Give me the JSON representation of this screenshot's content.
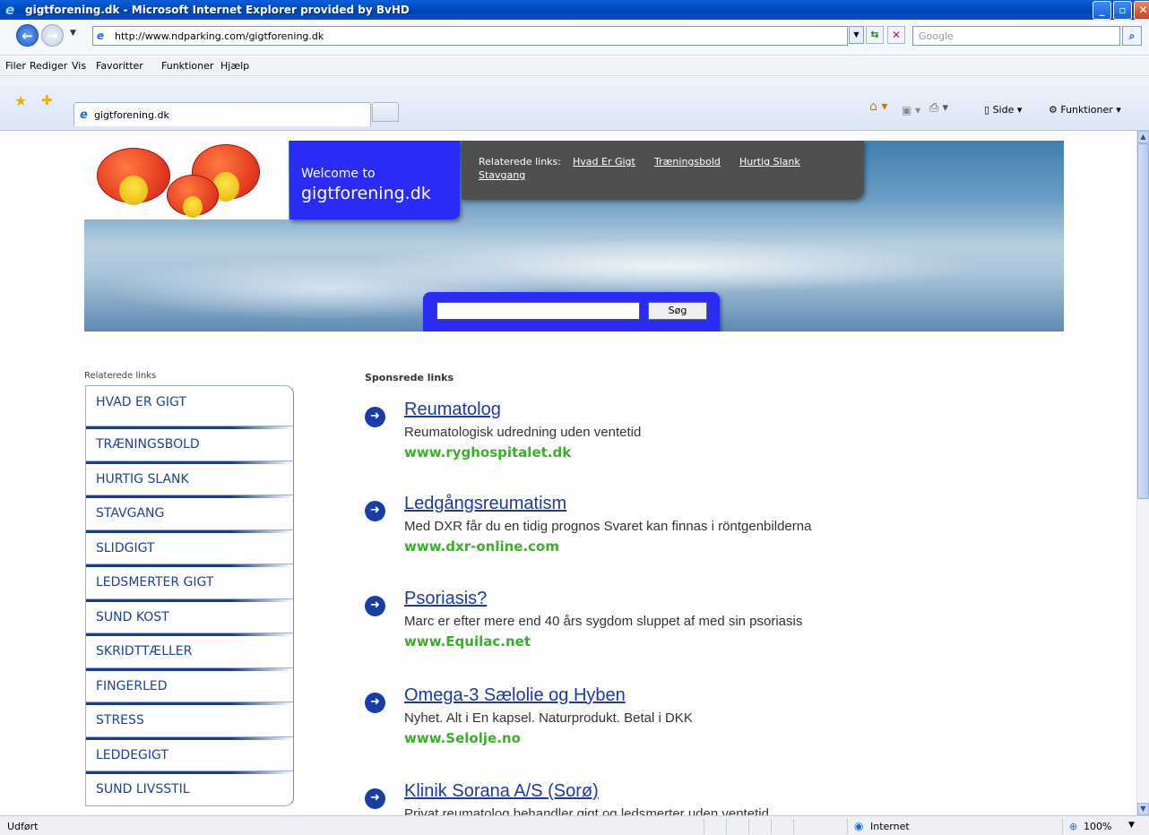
{
  "window": {
    "title": "gigtforening.dk - Microsoft Internet Explorer provided by BvHD"
  },
  "address": {
    "url": "http://www.ndparking.com/gigtforening.dk",
    "search_placeholder": "Google"
  },
  "menu": [
    "Filer",
    "Rediger",
    "Vis",
    "Favoritter",
    "Funktioner",
    "Hjælp"
  ],
  "tab": {
    "label": "gigtforening.dk"
  },
  "toolbar": {
    "page_label": "Side",
    "tools_label": "Funktioner"
  },
  "hero": {
    "welcome_line1": "Welcome to",
    "welcome_line2": "gigtforening.dk",
    "related_label": "Relaterede links:",
    "related_links": [
      "Hvad Er Gigt",
      "Træningsbold",
      "Hurtig Slank",
      "Stavgang"
    ],
    "search_button": "Søg"
  },
  "sidebar": {
    "title": "Relaterede links",
    "items": [
      "HVAD ER GIGT",
      "TRÆNINGSBOLD",
      "HURTIG SLANK",
      "STAVGANG",
      "SLIDGIGT",
      "LEDSMERTER GIGT",
      "SUND KOST",
      "SKRIDTTÆLLER",
      "FINGERLED",
      "STRESS",
      "LEDDEGIGT",
      "SUND LIVSSTIL"
    ]
  },
  "sponsored": {
    "title": "Sponsrede links",
    "ads": [
      {
        "headline": "Reumatolog",
        "desc": "Reumatologisk udredning uden ventetid",
        "url": "www.ryghospitalet.dk"
      },
      {
        "headline": "Ledgångsreumatism",
        "desc": "Med DXR får du en tidig prognos Svaret kan finnas i röntgenbilderna",
        "url": "www.dxr-online.com"
      },
      {
        "headline": "Psoriasis?",
        "desc": "Marc er efter mere end 40 års sygdom sluppet af med sin psoriasis",
        "url": "www.Equilac.net"
      },
      {
        "headline": "Omega-3 Sælolie og Hyben",
        "desc": "Nyhet. Alt i En kapsel. Naturprodukt. Betal i DKK",
        "url": "www.Selolje.no"
      },
      {
        "headline": "Klinik Sorana A/S (Sorø)",
        "desc": "Privat reumatolog behandler gigt og ledsmerter uden ventetid",
        "url": ""
      }
    ]
  },
  "status": {
    "text": "Udført",
    "zone": "Internet",
    "zoom": "100%"
  },
  "colors": {
    "brand_blue": "#2a2cf5",
    "link_blue": "#1b3aa8",
    "ad_url_green": "#3ab02a"
  }
}
